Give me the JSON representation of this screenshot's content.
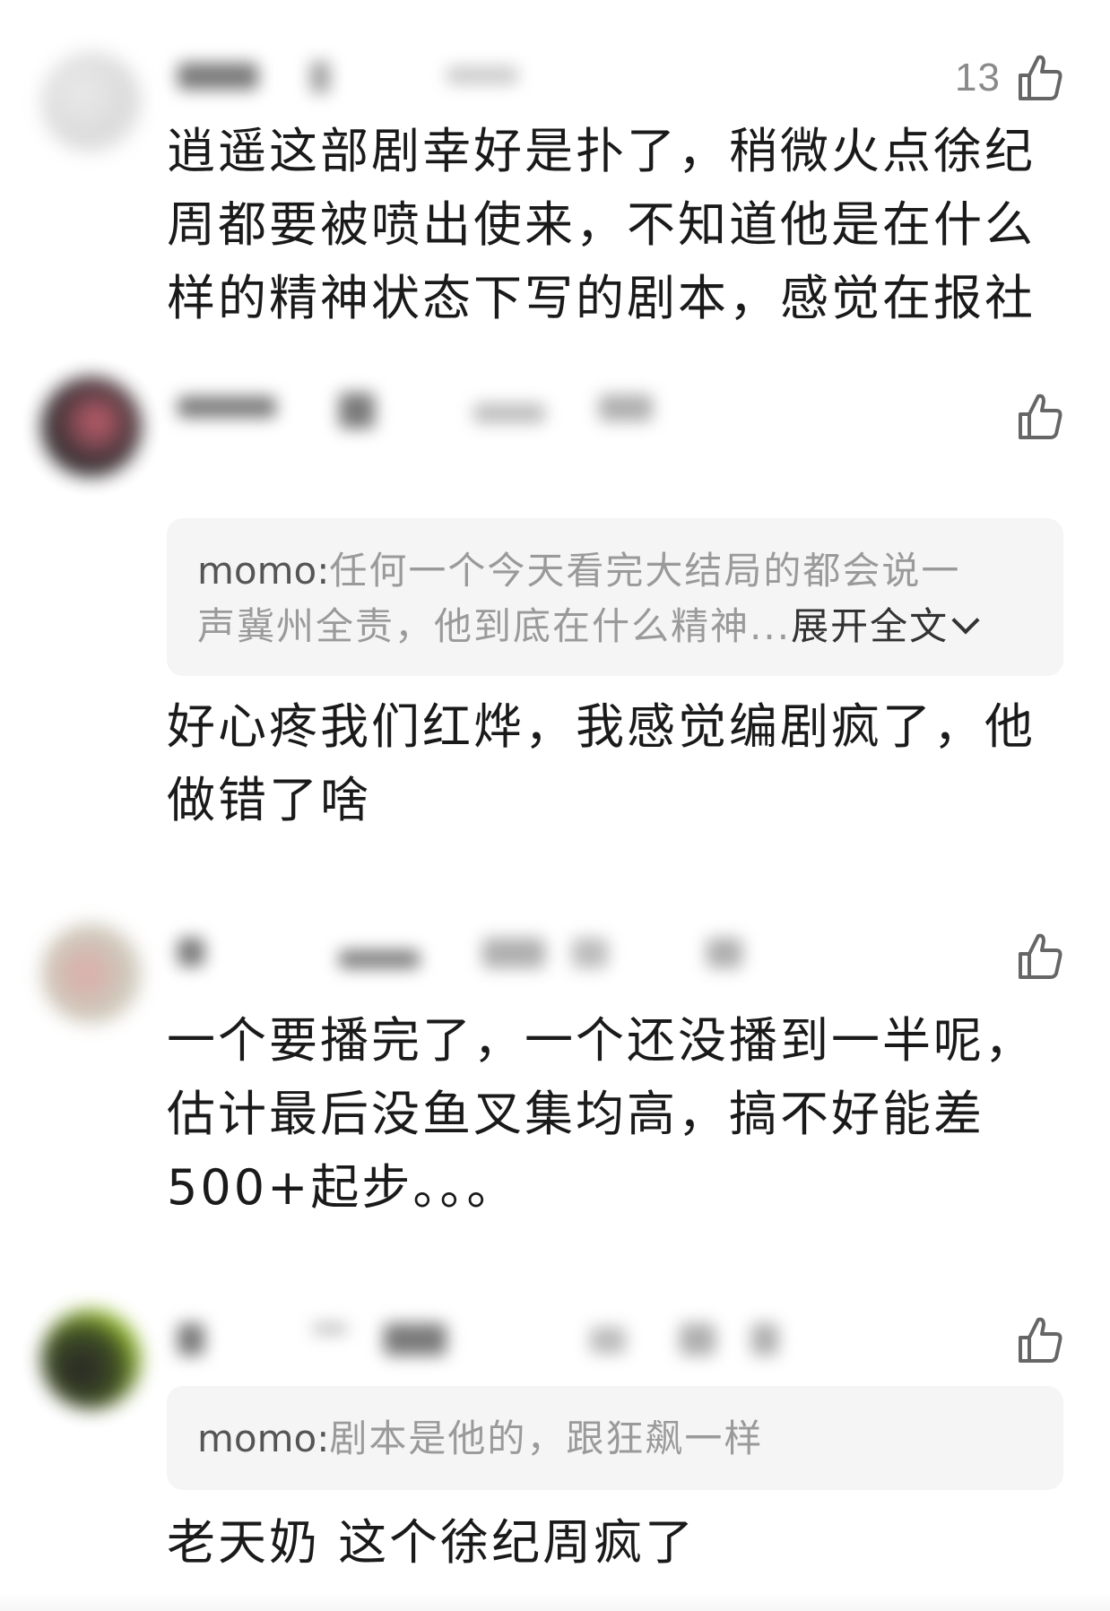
{
  "like_icon": "thumbs-up-outline-icon",
  "colors": {
    "text": "#1a1a1a",
    "muted": "#8a8a8a",
    "reply_bg": "#f5f5f5",
    "reply_text": "#9a9a9a"
  },
  "comments": [
    {
      "like_count": "13",
      "text_lines": [
        "逍遥这部剧幸好是扑了，稍微火点徐纪",
        "周都要被喷出使来，不知道他是在什么",
        "样的精神状态下写的剧本，感觉在报社"
      ]
    },
    {
      "like_count": "",
      "reply": {
        "author": "momo:",
        "text_lines": [
          "任何一个今天看完大结局的都会说一",
          "声冀州全责，他到底在什么精神..."
        ],
        "expand_label": "展开全文"
      },
      "text_lines": [
        "好心疼我们红烨，我感觉编剧疯了，他",
        "做错了啥"
      ]
    },
    {
      "like_count": "",
      "text_lines": [
        "一个要播完了，一个还没播到一半呢，",
        "估计最后没鱼叉集均高，搞不好能差",
        "500+起步。。。"
      ]
    },
    {
      "like_count": "",
      "reply": {
        "author": "momo:",
        "text_lines": [
          "剧本是他的，跟狂飙一样"
        ]
      },
      "text_lines": [
        "老天奶 这个徐纪周疯了"
      ]
    }
  ]
}
